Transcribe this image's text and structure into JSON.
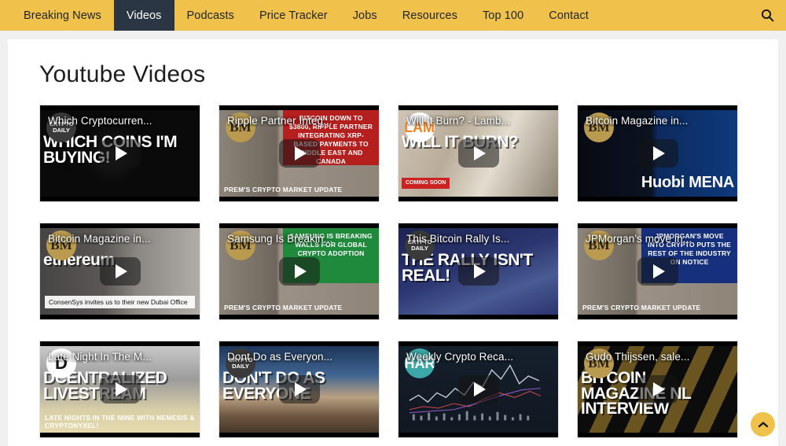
{
  "nav": {
    "items": [
      {
        "label": "Breaking News",
        "active": false
      },
      {
        "label": "Videos",
        "active": true
      },
      {
        "label": "Podcasts",
        "active": false
      },
      {
        "label": "Price Tracker",
        "active": false
      },
      {
        "label": "Jobs",
        "active": false
      },
      {
        "label": "Resources",
        "active": false
      },
      {
        "label": "Top 100",
        "active": false
      },
      {
        "label": "Contact",
        "active": false
      }
    ],
    "search_icon": "search-icon",
    "bg_color": "#f0c14b",
    "active_bg_color": "#2b3644"
  },
  "page": {
    "title": "Youtube Videos",
    "background": "#f0f0f0",
    "card_background": "#ffffff"
  },
  "scroll_top": {
    "icon": "chevron-up-icon",
    "color": "#f0c14b"
  },
  "videos": [
    {
      "title": "Which Cryptocurren...",
      "badge": "CRYPTO DAILY",
      "badge_kind": "cd",
      "art_big": "WHICH COINS I'M BUYING!",
      "play_icon": "play-icon"
    },
    {
      "title": "Ripple Partner Integ...",
      "badge": "BM",
      "badge_kind": "bm",
      "banner": "BITCOIN DOWN TO $3800, RIPPLE PARTNER INTEGRATING XRP-BASED PAYMENTS TO MIDDLE EAST AND CANADA",
      "lower": "PREM'S CRYPTO MARKET UPDATE",
      "play_icon": "play-icon"
    },
    {
      "title": "Will It Burn? - Lamb...",
      "badge": "FLAME",
      "badge_kind": "fl",
      "art_big": "WILL IT BURN?",
      "tag": "COMING SOON",
      "play_icon": "play-icon"
    },
    {
      "title": "Bitcoin Magazine in...",
      "badge": "BM",
      "badge_kind": "bm",
      "wordmark": "Huobi MENA",
      "play_icon": "play-icon"
    },
    {
      "title": "Bitcoin Magazine in...",
      "badge": "BM",
      "badge_kind": "bm",
      "caption": "ConsenSys invites us to their new Dubai Office",
      "art_big": "ethereum",
      "play_icon": "play-icon"
    },
    {
      "title": "Samsung Is Breakin...",
      "badge": "BM",
      "badge_kind": "bm",
      "banner": "SAMSUNG IS BREAKING WALLS FOR GLOBAL CRYPTO ADOPTION",
      "lower": "PREM'S CRYPTO MARKET UPDATE",
      "play_icon": "play-icon"
    },
    {
      "title": "This Bitcoin Rally Is...",
      "badge": "CRYPTO DAILY",
      "badge_kind": "cd",
      "art_big": "THE RALLY ISN'T REAL!",
      "play_icon": "play-icon"
    },
    {
      "title": "JPMorgan's move in...",
      "badge": "BM",
      "badge_kind": "bm",
      "banner": "JPMORGAN'S MOVE INTO CRYPTO PUTS THE REST OF THE INDUSTRY ON NOTICE",
      "lower": "PREM'S CRYPTO MARKET UPDATE",
      "play_icon": "play-icon"
    },
    {
      "title": "Late Night In The M...",
      "badge": "D",
      "badge_kind": "dc",
      "art_big": "DCENTRALIZED LIVESTREAM",
      "lower": "LATE NIGHTS IN THE MINE WITH NEMESIS & CRYPTONYXEL!",
      "play_icon": "play-icon"
    },
    {
      "title": "Dont Do as Everyon...",
      "badge": "CRYPTO DAILY",
      "badge_kind": "cd",
      "art_big": "DON'T DO AS EVERYONE",
      "play_icon": "play-icon"
    },
    {
      "title": "Weekly Crypto Reca...",
      "badge": "SHARE",
      "badge_kind": "sh",
      "play_icon": "play-icon"
    },
    {
      "title": "Gudo Thijssen, sale...",
      "badge": "BM",
      "badge_kind": "bm",
      "art_big": "BITCOIN MAGAZINE NL INTERVIEW",
      "play_icon": "play-icon"
    }
  ]
}
